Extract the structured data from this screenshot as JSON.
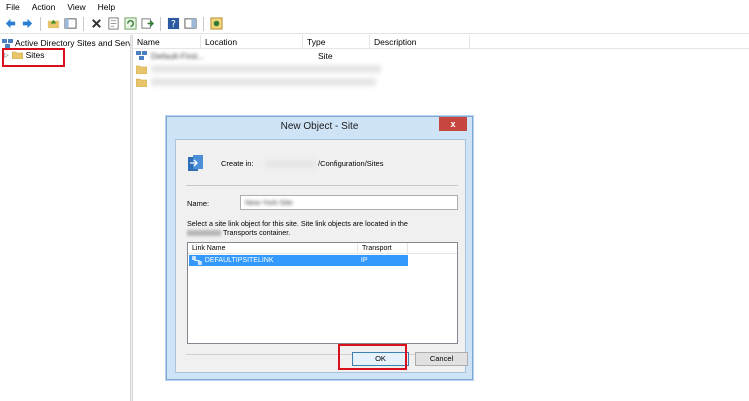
{
  "menu": [
    "File",
    "Action",
    "View",
    "Help"
  ],
  "toolbar": {
    "icons": [
      "back-icon",
      "forward-icon",
      "up-folder-icon",
      "show-hide-tree-icon",
      "delete-icon",
      "properties-icon",
      "refresh-icon",
      "export-list-icon",
      "help-icon",
      "action-pane-icon",
      "new-site-icon"
    ]
  },
  "tree": {
    "root_label": "Active Directory Sites and Servic",
    "child_label": "Sites"
  },
  "list": {
    "columns": [
      "Name",
      "Location",
      "Type",
      "Description"
    ],
    "rows": [
      {
        "name": "Default-First...",
        "type": "Site"
      },
      {
        "name": "",
        "type": ""
      },
      {
        "name": "",
        "type": ""
      }
    ]
  },
  "dialog": {
    "title": "New Object - Site",
    "close_label": "x",
    "create_in_label": "Create in:",
    "create_in_path": "/Configuration/Sites",
    "name_label": "Name:",
    "name_value": "New-York-Site",
    "info_line1": "Select a site link object for this site.  Site link objects are located in the",
    "info_line2": "Transports container.",
    "table_columns": [
      "Link Name",
      "Transport"
    ],
    "table_rows": [
      {
        "link_name": "DEFAULTIPSITELINK",
        "transport": "IP"
      }
    ],
    "ok_label": "OK",
    "cancel_label": "Cancel"
  },
  "colors": {
    "highlight_red": "#d9101b",
    "selection_blue": "#3399ff",
    "dialog_frame": "#cfe3f7",
    "close_button": "#c7463f"
  }
}
